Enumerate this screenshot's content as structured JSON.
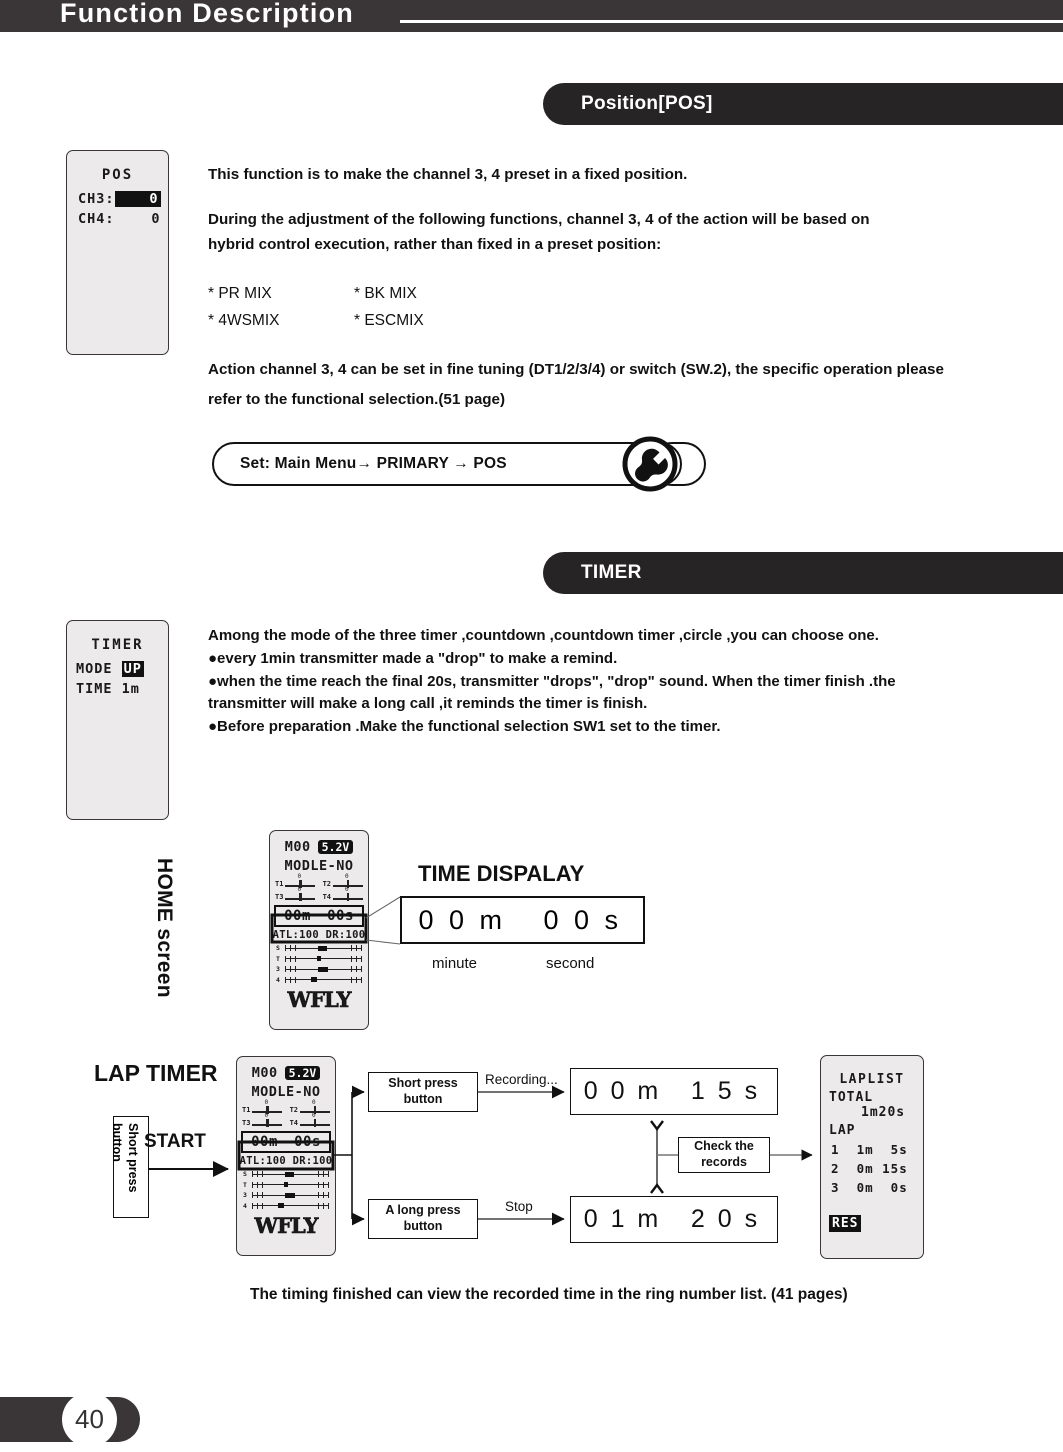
{
  "header": {
    "title": "Function Description"
  },
  "sections": {
    "pos_title": "Position[POS]",
    "timer_title": "TIMER"
  },
  "pos_lcd": {
    "title": "POS",
    "ch3_label": "CH3:",
    "ch3_value": "0",
    "ch4_label": "CH4:",
    "ch4_value": "0"
  },
  "pos_body": {
    "p1": "This function is to make the channel 3, 4 preset in a fixed position.",
    "p2": "During the adjustment of the following functions, channel 3, 4 of the action will be based on hybrid control execution, rather than fixed in a preset position:",
    "mix": [
      {
        "left": "* PR  MIX",
        "right": "* BK  MIX"
      },
      {
        "left": "* 4WSMIX",
        "right": "* ESCMIX"
      }
    ],
    "p3": "Action channel 3, 4 can be set in fine tuning (DT1/2/3/4) or switch (SW.2), the specific operation please  refer to the functional selection.(51 page)"
  },
  "set_path": {
    "text": "Set: Main Menu→ PRIMARY → POS",
    "icon": "wrench-icon"
  },
  "timer_lcd": {
    "title": "TIMER",
    "mode_label": "MODE",
    "mode_value": "UP",
    "time_label": "TIME",
    "time_value": "1m"
  },
  "timer_body": {
    "lines": [
      "Among the mode of the three timer ,countdown ,countdown timer ,circle ,you can choose one.",
      "●every 1min transmitter  made a \"drop\" to make a remind.",
      "●when the time reach the final 20s, transmitter  \"drops\", \"drop\" sound. When the timer finish .the transmitter will make a long call ,it reminds the timer is finish.",
      "●Before preparation .Make the functional selection SW1 set to the timer."
    ]
  },
  "home_screen": {
    "label": "HOME screen",
    "model": "M00",
    "battery": "5.2V",
    "model_no": "MODLE-NO",
    "trims": [
      "T1",
      "T2",
      "T3",
      "T4"
    ],
    "trim_zero": "0",
    "time_min": "00m",
    "time_sec": "00s",
    "atl": "ATL:100",
    "dr": "DR:100",
    "bars": [
      "S",
      "T",
      "3",
      "4"
    ],
    "brand": "WFLY"
  },
  "time_display": {
    "title": "TIME DISPALAY",
    "minutes": "0 0 m",
    "seconds": "0 0 s",
    "minute_label": "minute",
    "second_label": "second"
  },
  "lap_timer": {
    "title": "LAP TIMER",
    "short_press_left": "Short press\nbutton",
    "start_label": "START",
    "short_press_box": "Short press button",
    "short_press_box_l1": "Short press",
    "short_press_box_l2": "button",
    "long_press_box_l1": "A long press",
    "long_press_box_l2": "button",
    "recording_label": "Recording...",
    "stop_label": "Stop",
    "check_records_l1": "Check the",
    "check_records_l2": "records",
    "recording_time_min": "0 0 m",
    "recording_time_sec": "1 5 s",
    "stop_time_min": "0 1 m",
    "stop_time_sec": "2 0 s"
  },
  "laplist": {
    "title": "LAPLIST",
    "total_label": "TOTAL",
    "total_value": "1m20s",
    "lap_label": "LAP",
    "rows": [
      "1  1m  5s",
      "2  0m 15s",
      "3  0m  0s"
    ],
    "res": "RES"
  },
  "caption": "The timing finished can view the recorded time in the ring number list. (41 pages)",
  "page_number": "40"
}
